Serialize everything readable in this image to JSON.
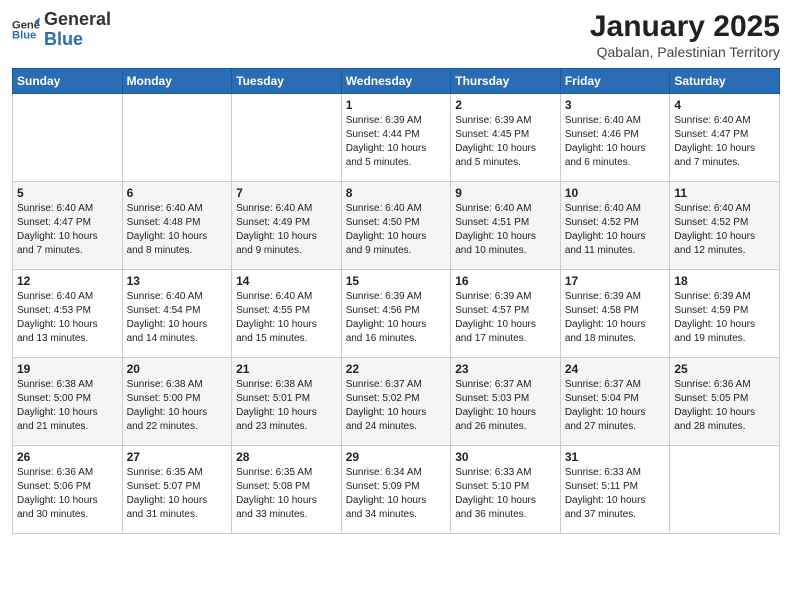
{
  "header": {
    "logo_general": "General",
    "logo_blue": "Blue",
    "title": "January 2025",
    "subtitle": "Qabalan, Palestinian Territory"
  },
  "weekdays": [
    "Sunday",
    "Monday",
    "Tuesday",
    "Wednesday",
    "Thursday",
    "Friday",
    "Saturday"
  ],
  "rows": [
    [
      {
        "num": "",
        "info": ""
      },
      {
        "num": "",
        "info": ""
      },
      {
        "num": "",
        "info": ""
      },
      {
        "num": "1",
        "info": "Sunrise: 6:39 AM\nSunset: 4:44 PM\nDaylight: 10 hours\nand 5 minutes."
      },
      {
        "num": "2",
        "info": "Sunrise: 6:39 AM\nSunset: 4:45 PM\nDaylight: 10 hours\nand 5 minutes."
      },
      {
        "num": "3",
        "info": "Sunrise: 6:40 AM\nSunset: 4:46 PM\nDaylight: 10 hours\nand 6 minutes."
      },
      {
        "num": "4",
        "info": "Sunrise: 6:40 AM\nSunset: 4:47 PM\nDaylight: 10 hours\nand 7 minutes."
      }
    ],
    [
      {
        "num": "5",
        "info": "Sunrise: 6:40 AM\nSunset: 4:47 PM\nDaylight: 10 hours\nand 7 minutes."
      },
      {
        "num": "6",
        "info": "Sunrise: 6:40 AM\nSunset: 4:48 PM\nDaylight: 10 hours\nand 8 minutes."
      },
      {
        "num": "7",
        "info": "Sunrise: 6:40 AM\nSunset: 4:49 PM\nDaylight: 10 hours\nand 9 minutes."
      },
      {
        "num": "8",
        "info": "Sunrise: 6:40 AM\nSunset: 4:50 PM\nDaylight: 10 hours\nand 9 minutes."
      },
      {
        "num": "9",
        "info": "Sunrise: 6:40 AM\nSunset: 4:51 PM\nDaylight: 10 hours\nand 10 minutes."
      },
      {
        "num": "10",
        "info": "Sunrise: 6:40 AM\nSunset: 4:52 PM\nDaylight: 10 hours\nand 11 minutes."
      },
      {
        "num": "11",
        "info": "Sunrise: 6:40 AM\nSunset: 4:52 PM\nDaylight: 10 hours\nand 12 minutes."
      }
    ],
    [
      {
        "num": "12",
        "info": "Sunrise: 6:40 AM\nSunset: 4:53 PM\nDaylight: 10 hours\nand 13 minutes."
      },
      {
        "num": "13",
        "info": "Sunrise: 6:40 AM\nSunset: 4:54 PM\nDaylight: 10 hours\nand 14 minutes."
      },
      {
        "num": "14",
        "info": "Sunrise: 6:40 AM\nSunset: 4:55 PM\nDaylight: 10 hours\nand 15 minutes."
      },
      {
        "num": "15",
        "info": "Sunrise: 6:39 AM\nSunset: 4:56 PM\nDaylight: 10 hours\nand 16 minutes."
      },
      {
        "num": "16",
        "info": "Sunrise: 6:39 AM\nSunset: 4:57 PM\nDaylight: 10 hours\nand 17 minutes."
      },
      {
        "num": "17",
        "info": "Sunrise: 6:39 AM\nSunset: 4:58 PM\nDaylight: 10 hours\nand 18 minutes."
      },
      {
        "num": "18",
        "info": "Sunrise: 6:39 AM\nSunset: 4:59 PM\nDaylight: 10 hours\nand 19 minutes."
      }
    ],
    [
      {
        "num": "19",
        "info": "Sunrise: 6:38 AM\nSunset: 5:00 PM\nDaylight: 10 hours\nand 21 minutes."
      },
      {
        "num": "20",
        "info": "Sunrise: 6:38 AM\nSunset: 5:00 PM\nDaylight: 10 hours\nand 22 minutes."
      },
      {
        "num": "21",
        "info": "Sunrise: 6:38 AM\nSunset: 5:01 PM\nDaylight: 10 hours\nand 23 minutes."
      },
      {
        "num": "22",
        "info": "Sunrise: 6:37 AM\nSunset: 5:02 PM\nDaylight: 10 hours\nand 24 minutes."
      },
      {
        "num": "23",
        "info": "Sunrise: 6:37 AM\nSunset: 5:03 PM\nDaylight: 10 hours\nand 26 minutes."
      },
      {
        "num": "24",
        "info": "Sunrise: 6:37 AM\nSunset: 5:04 PM\nDaylight: 10 hours\nand 27 minutes."
      },
      {
        "num": "25",
        "info": "Sunrise: 6:36 AM\nSunset: 5:05 PM\nDaylight: 10 hours\nand 28 minutes."
      }
    ],
    [
      {
        "num": "26",
        "info": "Sunrise: 6:36 AM\nSunset: 5:06 PM\nDaylight: 10 hours\nand 30 minutes."
      },
      {
        "num": "27",
        "info": "Sunrise: 6:35 AM\nSunset: 5:07 PM\nDaylight: 10 hours\nand 31 minutes."
      },
      {
        "num": "28",
        "info": "Sunrise: 6:35 AM\nSunset: 5:08 PM\nDaylight: 10 hours\nand 33 minutes."
      },
      {
        "num": "29",
        "info": "Sunrise: 6:34 AM\nSunset: 5:09 PM\nDaylight: 10 hours\nand 34 minutes."
      },
      {
        "num": "30",
        "info": "Sunrise: 6:33 AM\nSunset: 5:10 PM\nDaylight: 10 hours\nand 36 minutes."
      },
      {
        "num": "31",
        "info": "Sunrise: 6:33 AM\nSunset: 5:11 PM\nDaylight: 10 hours\nand 37 minutes."
      },
      {
        "num": "",
        "info": ""
      }
    ]
  ]
}
